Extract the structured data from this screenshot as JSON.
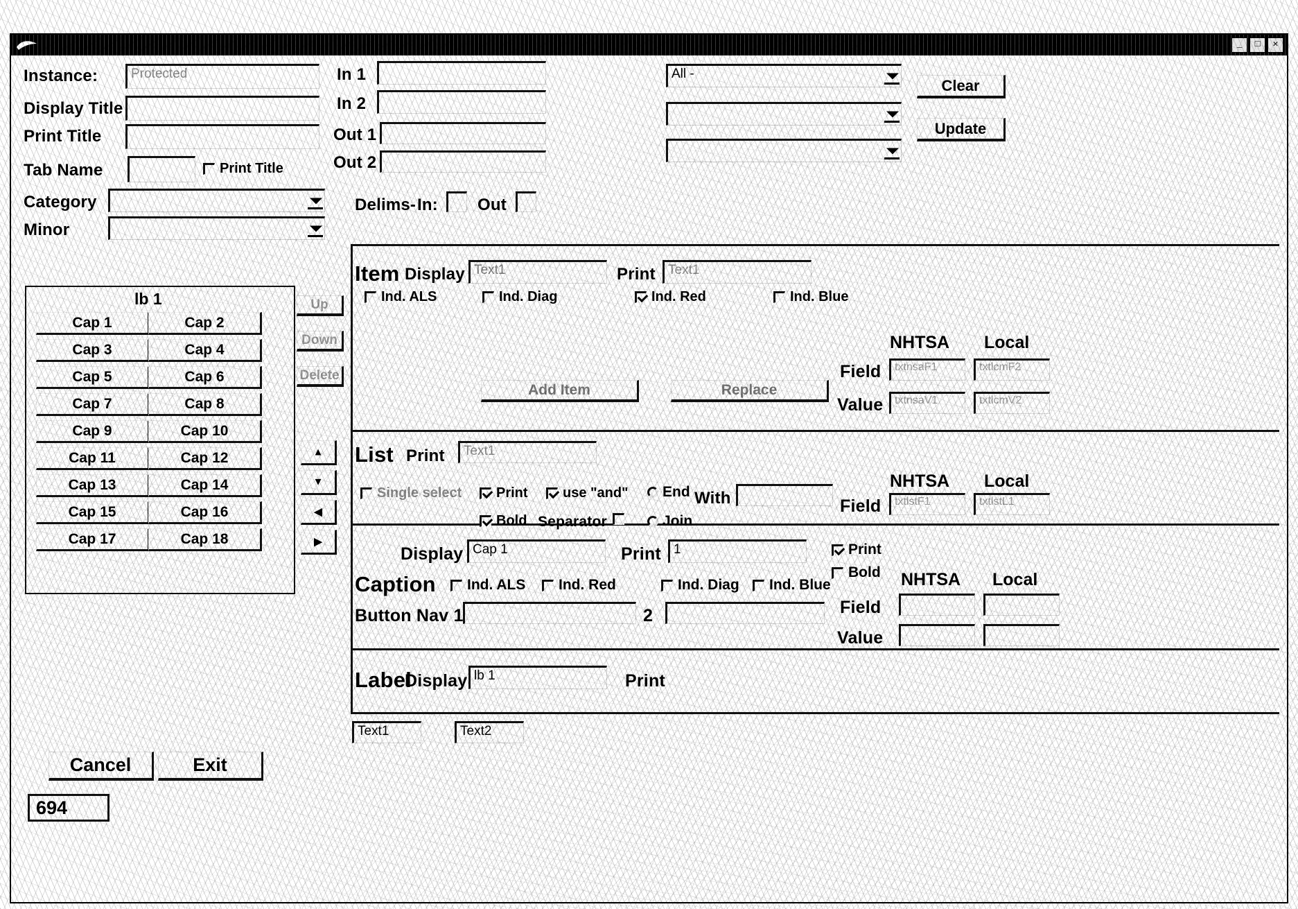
{
  "window": {
    "title": "",
    "controls": {
      "minimize": "_",
      "maximize": "□",
      "close": "✕"
    },
    "app_icon": "pointer-icon"
  },
  "left_form": {
    "instance_label": "Instance:",
    "instance_value": "Protected",
    "display_title_label": "Display Title",
    "display_title_value": "",
    "print_title_label": "Print Title",
    "print_title_value": "",
    "tab_name_label": "Tab Name",
    "tab_name_value": "",
    "print_title_checkbox": "Print Title",
    "print_title_checked": false,
    "category_label": "Category",
    "category_value": "",
    "minor_label": "Minor",
    "minor_value": ""
  },
  "io_fields": {
    "in1_label": "In 1",
    "in1_value": "",
    "in2_label": "In 2",
    "in2_value": "",
    "out1_label": "Out 1",
    "out1_value": "",
    "out2_label": "Out 2",
    "out2_value": "",
    "delims_label": "Delims-",
    "delims_in_label": "In:",
    "delims_in_value": "",
    "delims_out_label": "Out",
    "delims_out_value": ""
  },
  "top_right": {
    "combo1_value": "All -",
    "combo2_value": "",
    "combo3_value": "",
    "clear_button": "Clear",
    "update_button": "Update"
  },
  "list_panel": {
    "header": "lb 1",
    "captions": [
      "Cap  1",
      "Cap  2",
      "Cap  3",
      "Cap  4",
      "Cap  5",
      "Cap  6",
      "Cap  7",
      "Cap  8",
      "Cap  9",
      "Cap  10",
      "Cap  11",
      "Cap  12",
      "Cap  13",
      "Cap  14",
      "Cap  15",
      "Cap  16",
      "Cap  17",
      "Cap  18"
    ],
    "cancel_button": "Cancel",
    "exit_button": "Exit",
    "counter_value": "694"
  },
  "order_buttons": {
    "up": "Up",
    "down": "Down",
    "delete": "Delete"
  },
  "arrow_buttons": [
    {
      "name": "move-up-arrow",
      "glyph": "▲"
    },
    {
      "name": "move-down-arrow",
      "glyph": "▼"
    },
    {
      "name": "move-left-arrow",
      "glyph": "◀"
    },
    {
      "name": "move-right-arrow",
      "glyph": "▶"
    }
  ],
  "item_section": {
    "title": "Item",
    "display_label": "Display",
    "display_value": "Text1",
    "print_label": "Print",
    "print_value": "Text1",
    "checkboxes": [
      {
        "label": "Ind. ALS",
        "checked": false
      },
      {
        "label": "Ind. Diag",
        "checked": false
      },
      {
        "label": "Ind. Red",
        "checked": true
      },
      {
        "label": "Ind. Blue",
        "checked": false
      }
    ],
    "add_item_button": "Add Item",
    "replace_button": "Replace",
    "grid": {
      "col1": "NHTSA",
      "col2": "Local",
      "row_field": "Field",
      "row_value": "Value",
      "field_nhtsa": "txtnsaF1",
      "field_local": "txtlcmF2",
      "value_nhtsa": "txtnsaV1",
      "value_local": "txtlcmV2"
    }
  },
  "list_section": {
    "title": "List",
    "print_label": "Print",
    "print_value": "Text1",
    "checkboxes": [
      {
        "label": "Single select",
        "checked": false
      },
      {
        "label": "Print",
        "checked": true
      },
      {
        "label": "use \"and\"",
        "checked": true
      },
      {
        "label": "Bold",
        "checked": true
      },
      {
        "label": "Separator",
        "checked": false
      }
    ],
    "radios": [
      {
        "label": "End",
        "selected": false
      },
      {
        "label": "Join",
        "selected": false
      }
    ],
    "with_label": "With",
    "with_value": "",
    "grid": {
      "col1": "NHTSA",
      "col2": "Local",
      "row_field": "Field",
      "field_nhtsa": "txtlstF1",
      "field_local": "txtlstL1"
    }
  },
  "caption_section": {
    "title": "Caption",
    "display_label": "Display",
    "display_value": "Cap  1",
    "print_label": "Print",
    "print_value": "1",
    "print_checkbox": "Print",
    "print_checked": true,
    "bold_checkbox": "Bold",
    "bold_checked": false,
    "checkboxes": [
      {
        "label": "Ind. ALS",
        "checked": false
      },
      {
        "label": "Ind. Red",
        "checked": false
      },
      {
        "label": "Ind. Diag",
        "checked": false
      },
      {
        "label": "Ind. Blue",
        "checked": false
      }
    ],
    "button_nav_label": "Button Nav 1",
    "button_nav1_value": "",
    "button_nav2_label": "2",
    "button_nav2_value": "",
    "grid": {
      "col1": "NHTSA",
      "col2": "Local",
      "row_field": "Field",
      "row_value": "Value",
      "field_nhtsa": "",
      "field_local": "",
      "value_nhtsa": "",
      "value_local": ""
    }
  },
  "label_section": {
    "title": "Label",
    "display_label": "Display",
    "display_value": "lb 1",
    "print_label": "Print",
    "print_value": ""
  },
  "bottom_fields": {
    "text1": "Text1",
    "text2": "Text2"
  }
}
